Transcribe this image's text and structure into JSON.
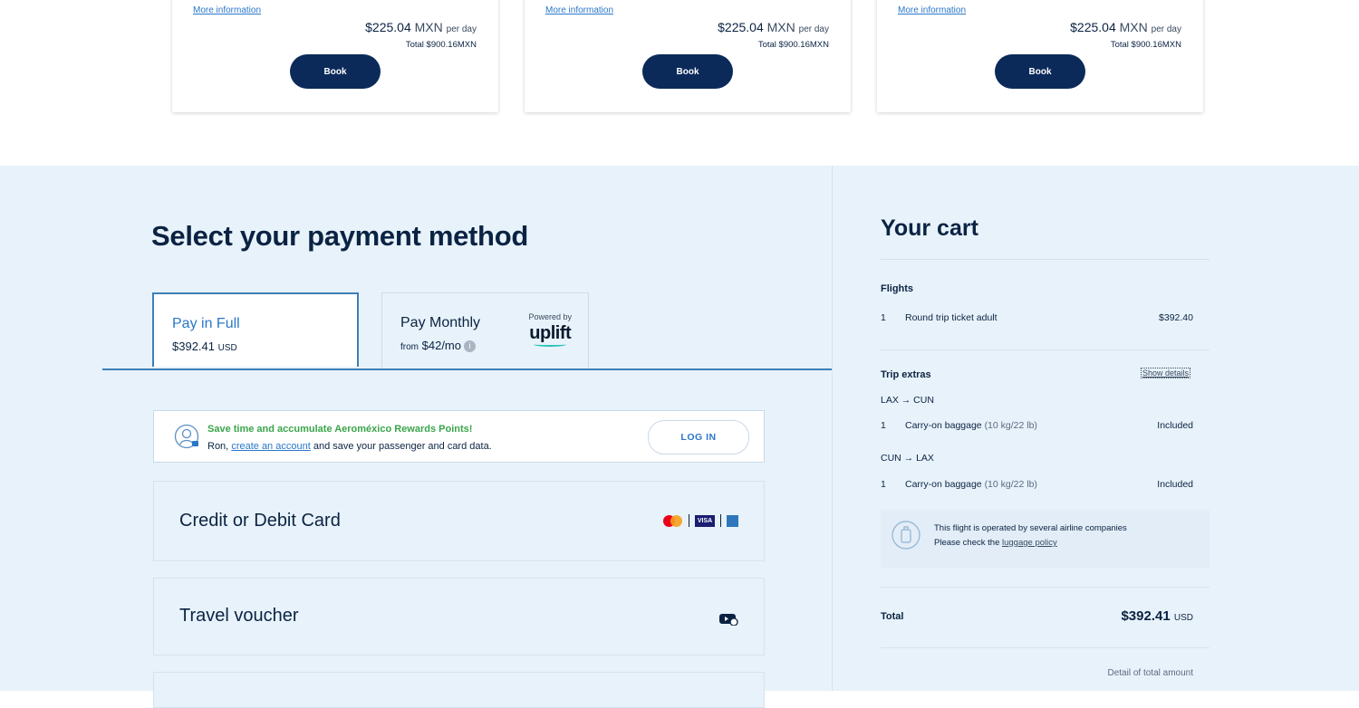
{
  "car_cards": [
    {
      "more_info": "More information",
      "price": "$225.04",
      "currency": "MXN",
      "per": "per day",
      "total": "Total $900.16MXN",
      "book": "Book"
    },
    {
      "more_info": "More information",
      "price": "$225.04",
      "currency": "MXN",
      "per": "per day",
      "total": "Total $900.16MXN",
      "book": "Book"
    },
    {
      "more_info": "More information",
      "price": "$225.04",
      "currency": "MXN",
      "per": "per day",
      "total": "Total $900.16MXN",
      "book": "Book"
    }
  ],
  "payment": {
    "title": "Select your payment method",
    "tab_full": {
      "label": "Pay in Full",
      "amount": "$392.41",
      "currency": "USD"
    },
    "tab_monthly": {
      "label": "Pay Monthly",
      "from": "from",
      "amount": "$42/mo",
      "info": "i",
      "powered_by": "Powered by",
      "brand": "uplift"
    },
    "rewards": {
      "headline": "Save time and accumulate Aeroméxico Rewards Points!",
      "line_prefix": "Ron,",
      "link": "create an account",
      "line_suffix": "and save your passenger and card data.",
      "login": "LOG IN"
    },
    "methods": {
      "credit": "Credit or Debit Card",
      "card_brand_visa": "VISA",
      "voucher": "Travel voucher"
    }
  },
  "cart": {
    "title": "Your cart",
    "flights_heading": "Flights",
    "flight_qty": "1",
    "flight_item": "Round trip ticket adult",
    "flight_price": "$392.40",
    "extras_heading": "Trip extras",
    "show_details": "Show details",
    "route1": "LAX → CUN",
    "route1_qty": "1",
    "route1_item": "Carry-on baggage",
    "route1_note": "(10 kg/22 lb)",
    "route1_status": "Included",
    "route2": "CUN → LAX",
    "route2_qty": "1",
    "route2_item": "Carry-on baggage",
    "route2_note": "(10 kg/22 lb)",
    "route2_status": "Included",
    "notice_line1": "This flight is operated by several airline companies",
    "notice_line2_prefix": "Please check the",
    "notice_link": "luggage policy",
    "total_label": "Total",
    "total_value": "$392.41",
    "total_currency": "USD",
    "detail_link": "Detail of total amount"
  },
  "colors": {
    "primary": "#0b2a5a",
    "accent": "#2a77c9",
    "panel_bg": "#e8f2fa",
    "rewards_green": "#3aa54b",
    "uplift_teal": "#2ac4b8"
  }
}
